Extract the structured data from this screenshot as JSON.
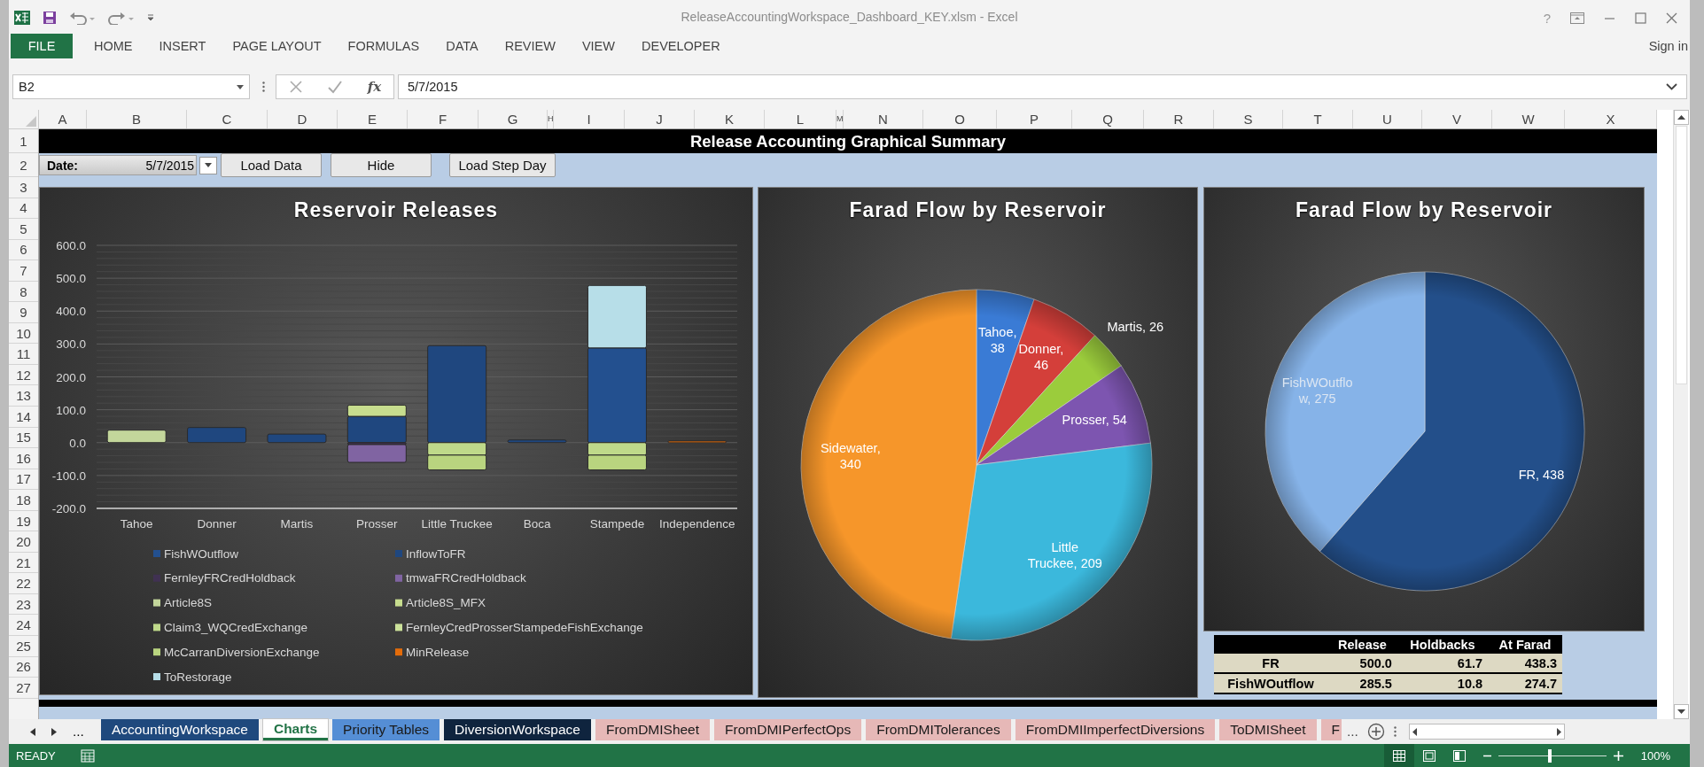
{
  "window": {
    "title": "ReleaseAccountingWorkspace_Dashboard_KEY.xlsm - Excel",
    "help": "?"
  },
  "ribbon": {
    "tabs": [
      {
        "label": "FILE",
        "selected": true
      },
      {
        "label": "HOME",
        "selected": false
      },
      {
        "label": "INSERT",
        "selected": false
      },
      {
        "label": "PAGE LAYOUT",
        "selected": false
      },
      {
        "label": "FORMULAS",
        "selected": false
      },
      {
        "label": "DATA",
        "selected": false
      },
      {
        "label": "REVIEW",
        "selected": false
      },
      {
        "label": "VIEW",
        "selected": false
      },
      {
        "label": "DEVELOPER",
        "selected": false
      }
    ],
    "sign_in": "Sign in"
  },
  "formula_bar": {
    "name_box": "B2",
    "function_label": "fx",
    "value": "5/7/2015"
  },
  "columns": [
    "A",
    "B",
    "C",
    "D",
    "E",
    "F",
    "G",
    "H",
    "I",
    "J",
    "K",
    "L",
    "M",
    "N",
    "O",
    "P",
    "Q",
    "R",
    "S",
    "T",
    "U",
    "V",
    "W",
    "X"
  ],
  "rows": [
    "1",
    "2",
    "3",
    "4",
    "5",
    "6",
    "7",
    "8",
    "9",
    "10",
    "11",
    "12",
    "13",
    "14",
    "15",
    "16",
    "17",
    "18",
    "19",
    "20",
    "21",
    "22",
    "23",
    "24",
    "25",
    "26",
    "27"
  ],
  "dashboard": {
    "title": "Release Accounting Graphical Summary",
    "date_label": "Date:",
    "date_value": "5/7/2015",
    "buttons": [
      "Load Data",
      "Hide",
      "Load Step Day"
    ]
  },
  "charts": [
    {
      "chart_data": {
        "type": "bar",
        "title": "Reservoir Releases",
        "stacked": true,
        "grid": true,
        "legend": true,
        "categories": [
          "Tahoe",
          "Donner",
          "Martis",
          "Prosser",
          "Little Truckee",
          "Boca",
          "Stampede",
          "Independence"
        ],
        "ylim": [
          -200,
          600
        ],
        "yticks": [
          {
            "value": 600,
            "label": "600.0"
          },
          {
            "value": 500,
            "label": "500.0"
          },
          {
            "value": 400,
            "label": "400.0"
          },
          {
            "value": 300,
            "label": "300.0"
          },
          {
            "value": 200,
            "label": "200.0"
          },
          {
            "value": 100,
            "label": "100.0"
          },
          {
            "value": 0,
            "label": "0.0"
          },
          {
            "value": -100,
            "label": "-100.0"
          },
          {
            "value": -200,
            "label": "-200.0"
          }
        ],
        "series": [
          {
            "name": "FishWOutflow",
            "color": "#23508f",
            "values": [
              null,
              null,
              null,
              null,
              null,
              null,
              288,
              null
            ]
          },
          {
            "name": "InflowToFR",
            "color": "#1f477f",
            "values": [
              null,
              46,
              26,
              80,
              295,
              8,
              null,
              null
            ]
          },
          {
            "name": "FernleyFRCredHoldback",
            "color": "#403152",
            "values": [
              null,
              null,
              null,
              -6,
              null,
              null,
              null,
              null
            ]
          },
          {
            "name": "tmwaFRCredHoldback",
            "color": "#8064a2",
            "values": [
              null,
              null,
              null,
              -54,
              null,
              null,
              null,
              null
            ]
          },
          {
            "name": "Article8S",
            "color": "#c3d69b",
            "values": [
              38,
              null,
              null,
              null,
              null,
              null,
              null,
              null
            ]
          },
          {
            "name": "Article8S_MFX",
            "color": "#c7dd8e",
            "values": [
              null,
              null,
              null,
              34,
              null,
              null,
              null,
              null
            ]
          },
          {
            "name": "Claim3_WQCredExchange",
            "color": "#bfd98a",
            "values": [
              null,
              null,
              null,
              null,
              -38,
              null,
              -38,
              null
            ]
          },
          {
            "name": "FernleyCredProsserStampedeFishExchange",
            "color": "#cce29a",
            "values": [
              null,
              null,
              null,
              null,
              null,
              null,
              null,
              null
            ]
          },
          {
            "name": "McCarranDiversionExchange",
            "color": "#b9d47f",
            "values": [
              null,
              null,
              null,
              null,
              -45,
              null,
              -45,
              null
            ]
          },
          {
            "name": "MinRelease",
            "color": "#e46c0a",
            "values": [
              null,
              null,
              null,
              null,
              null,
              null,
              null,
              5
            ]
          },
          {
            "name": "ToRestorage",
            "color": "#b7dee8",
            "values": [
              null,
              null,
              null,
              null,
              null,
              null,
              190,
              null
            ]
          }
        ]
      }
    },
    {
      "chart_data": {
        "type": "pie",
        "title": "Farad Flow by Reservoir",
        "data_labels": true,
        "value_labels": [
          "Tahoe, 38",
          "Donner, 46",
          "Martis, 26",
          "Prosser, 54",
          "Little Truckee, 209",
          "Sidewater, 340"
        ],
        "values": [
          38,
          46,
          26,
          54,
          209,
          340
        ]
      }
    },
    {
      "chart_data": {
        "type": "pie",
        "title": "Farad Flow by Reservoir",
        "data_labels": true,
        "value_labels": [
          "FR, 438",
          "FishWOutflow, 275"
        ],
        "values": [
          438,
          275
        ]
      }
    }
  ],
  "summary_table": {
    "columns": [
      "Release",
      "Holdbacks",
      "At Farad"
    ],
    "rows": [
      {
        "name": "FR",
        "cells": [
          "500.0",
          "61.7",
          "438.3"
        ]
      },
      {
        "name": "FishWOutflow",
        "cells": [
          "285.5",
          "10.8",
          "274.7"
        ]
      }
    ]
  },
  "sheet_tabs": {
    "more_left": "...",
    "tabs": [
      {
        "label": "AccountingWorkspace",
        "selected": false,
        "color": "#1f497d"
      },
      {
        "label": "Charts",
        "selected": true,
        "color": "#217346"
      },
      {
        "label": "Priority Tables",
        "selected": false,
        "color": "#558ed5"
      },
      {
        "label": "DiversionWorkspace",
        "selected": false,
        "color": "#0f243e"
      },
      {
        "label": "FromDMISheet",
        "selected": false,
        "color": "#e6b8b7"
      },
      {
        "label": "FromDMIPerfectOps",
        "selected": false,
        "color": "#e6b8b7"
      },
      {
        "label": "FromDMITolerances",
        "selected": false,
        "color": "#e6b8b7"
      },
      {
        "label": "FromDMIImperfectDiversions",
        "selected": false,
        "color": "#e6b8b7"
      },
      {
        "label": "ToDMISheet",
        "selected": false,
        "color": "#e6b8b7"
      },
      {
        "label": "F",
        "selected": false,
        "color": "#e6b8b7"
      }
    ],
    "more_right": "..."
  },
  "status_bar": {
    "status": "READY",
    "views": [
      {
        "selected": true
      },
      {
        "selected": false
      },
      {
        "selected": false
      }
    ],
    "zoom": {
      "level": 0.48,
      "reading": "100%"
    }
  }
}
